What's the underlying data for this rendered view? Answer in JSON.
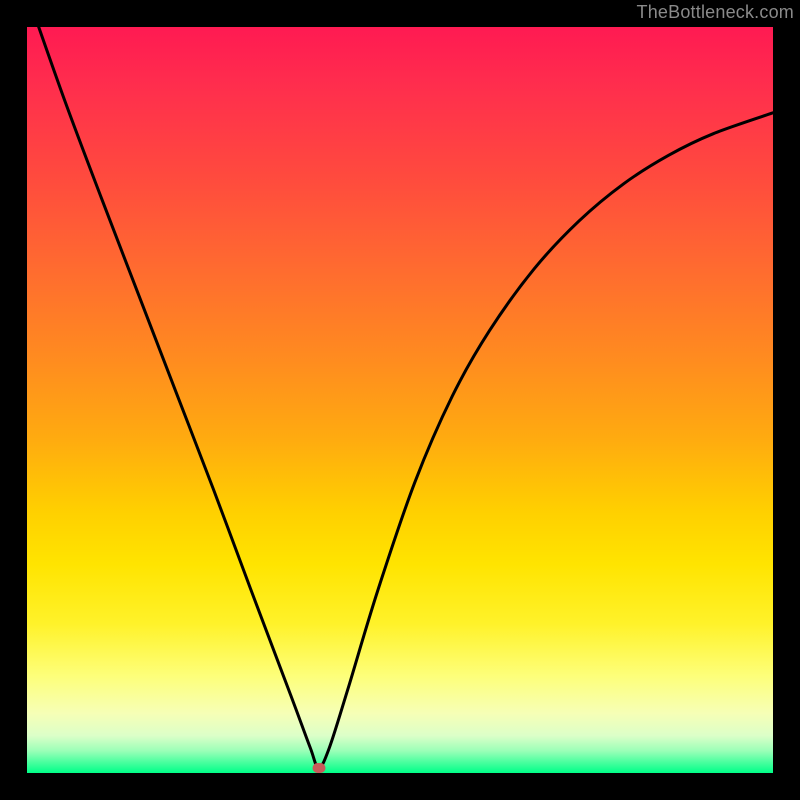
{
  "watermark": "TheBottleneck.com",
  "marker": {
    "x_frac": 0.391,
    "y_frac": 0.993
  },
  "chart_data": {
    "type": "line",
    "title": "",
    "xlabel": "",
    "ylabel": "",
    "xlim": [
      0,
      1
    ],
    "ylim": [
      0,
      1
    ],
    "series": [
      {
        "name": "curve",
        "x": [
          0.0,
          0.05,
          0.1,
          0.15,
          0.2,
          0.25,
          0.3,
          0.34,
          0.36,
          0.38,
          0.391,
          0.405,
          0.43,
          0.47,
          0.52,
          0.57,
          0.62,
          0.68,
          0.74,
          0.8,
          0.86,
          0.92,
          1.0
        ],
        "y": [
          1.045,
          0.903,
          0.77,
          0.64,
          0.51,
          0.38,
          0.246,
          0.14,
          0.087,
          0.033,
          0.007,
          0.033,
          0.112,
          0.244,
          0.39,
          0.505,
          0.593,
          0.676,
          0.74,
          0.79,
          0.828,
          0.857,
          0.885
        ]
      }
    ],
    "gradient_colors": [
      "#ff1a52",
      "#ff4a3e",
      "#ff8a20",
      "#ffd000",
      "#fff22a",
      "#dcffc8",
      "#00ff88"
    ],
    "marker_color": "#c85a5a"
  }
}
